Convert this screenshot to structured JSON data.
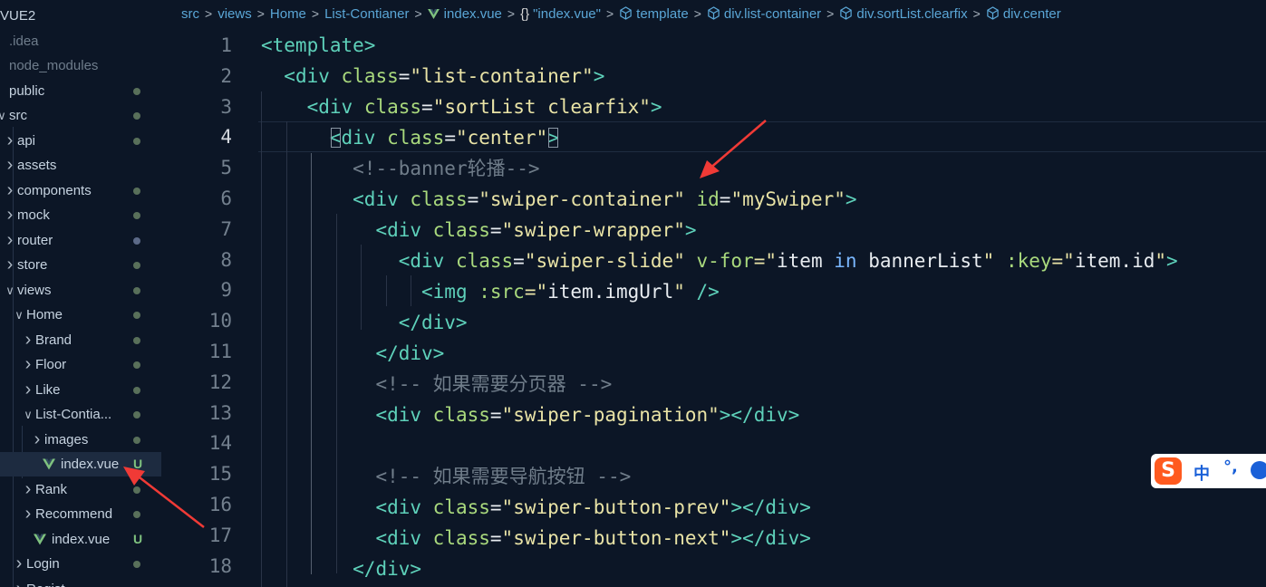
{
  "sidebar": {
    "root_label": "VUE2",
    "items": [
      {
        "label": ".idea",
        "dim": true
      },
      {
        "label": "node_modules",
        "dim": true
      },
      {
        "label": "public",
        "status": "dot"
      },
      {
        "label": "src",
        "status": "dot",
        "expanded": true
      },
      {
        "label": "api",
        "status": "dot"
      },
      {
        "label": "assets"
      },
      {
        "label": "components",
        "status": "dot"
      },
      {
        "label": "mock",
        "status": "dot"
      },
      {
        "label": "router",
        "status": "dot-blue"
      },
      {
        "label": "store",
        "status": "dot"
      },
      {
        "label": "views",
        "status": "dot",
        "expanded": true
      },
      {
        "label": "Home",
        "status": "dot",
        "expanded": true
      },
      {
        "label": "Brand",
        "status": "dot"
      },
      {
        "label": "Floor",
        "status": "dot"
      },
      {
        "label": "Like",
        "status": "dot"
      },
      {
        "label": "List-Contia...",
        "status": "dot",
        "expanded": true
      },
      {
        "label": "images",
        "status": "dot"
      },
      {
        "label": "index.vue",
        "status": "U",
        "selected": true,
        "icon": "vue-icon"
      },
      {
        "label": "Rank",
        "status": "dot"
      },
      {
        "label": "Recommend",
        "status": "dot"
      },
      {
        "label": "index.vue",
        "status": "U",
        "icon": "vue-icon"
      },
      {
        "label": "Login",
        "status": "dot"
      },
      {
        "label": "Regist..."
      }
    ]
  },
  "breadcrumb": {
    "items": [
      "src",
      "views",
      "Home",
      "List-Contianer",
      "index.vue",
      "\"index.vue\"",
      "template",
      "div.list-container",
      "div.sortList.clearfix",
      "div.center"
    ],
    "brace_icon": "{}"
  },
  "editor": {
    "active_line": 4,
    "lines": [
      {
        "n": "1"
      },
      {
        "n": "2"
      },
      {
        "n": "3"
      },
      {
        "n": "4"
      },
      {
        "n": "5"
      },
      {
        "n": "6"
      },
      {
        "n": "7"
      },
      {
        "n": "8"
      },
      {
        "n": "9"
      },
      {
        "n": "10"
      },
      {
        "n": "11"
      },
      {
        "n": "12"
      },
      {
        "n": "13"
      },
      {
        "n": "14"
      },
      {
        "n": "15"
      },
      {
        "n": "16"
      },
      {
        "n": "17"
      },
      {
        "n": "18"
      }
    ],
    "tokens": {
      "l1_tag": "<template>",
      "l2_open": "<div",
      "l2_attr": "class",
      "l2_eq": "=",
      "l2_val": "\"list-container\"",
      "l2_close": ">",
      "l3_open": "<div",
      "l3_attr": "class",
      "l3_eq": "=",
      "l3_val": "\"sortList clearfix\"",
      "l3_close": ">",
      "l4_lt": "<",
      "l4_open": "div",
      "l4_attr": "class",
      "l4_eq": "=",
      "l4_val": "\"center\"",
      "l4_close": ">",
      "l5_cmt": "<!--banner轮播-->",
      "l6_open": "<div",
      "l6_attr": "class",
      "l6_eq": "=",
      "l6_val": "\"swiper-container\"",
      "l6_attr2": "id",
      "l6_eq2": "=",
      "l6_val2": "\"mySwiper\"",
      "l6_close": ">",
      "l7_open": "<div",
      "l7_attr": "class",
      "l7_eq": "=",
      "l7_val": "\"swiper-wrapper\"",
      "l7_close": ">",
      "l8_open": "<div",
      "l8_attr": "class",
      "l8_eq": "=",
      "l8_val": "\"swiper-slide\"",
      "l8_attr2": "v-for",
      "l8_eq2": "=\"",
      "l8_item": "item",
      "l8_in": "in",
      "l8_list": "bannerList",
      "l8_q": "\"",
      "l8_attr3": ":key",
      "l8_eq3": "=\"",
      "l8_key": "item",
      "l8_dot": ".",
      "l8_id": "id",
      "l8_q2": "\"",
      "l8_close": ">",
      "l9_open": "<img",
      "l9_attr": ":src",
      "l9_eq": "=\"",
      "l9_item": "item",
      "l9_dot": ".",
      "l9_prop": "imgUrl",
      "l9_q": "\"",
      "l9_close": "/>",
      "l10_tag": "</div>",
      "l11_tag": "</div>",
      "l12_cmt": "<!-- 如果需要分页器 -->",
      "l13_open": "<div",
      "l13_attr": "class",
      "l13_eq": "=",
      "l13_val": "\"swiper-pagination\"",
      "l13_close": "></div>",
      "l15_cmt": "<!-- 如果需要导航按钮 -->",
      "l16_open": "<div",
      "l16_attr": "class",
      "l16_eq": "=",
      "l16_val": "\"swiper-button-prev\"",
      "l16_close": "></div>",
      "l17_open": "<div",
      "l17_attr": "class",
      "l17_eq": "=",
      "l17_val": "\"swiper-button-next\"",
      "l17_close": "></div>",
      "l18_tag": "</div>"
    }
  },
  "ime": {
    "logo": "S",
    "mode": "中",
    "punct": "°,",
    "icon": "smiley-icon"
  },
  "colors": {
    "tag": "#5ed1ba",
    "attr": "#a9d97d",
    "string": "#e9e3a6",
    "comment": "#707d8a",
    "background": "#0c1626"
  }
}
